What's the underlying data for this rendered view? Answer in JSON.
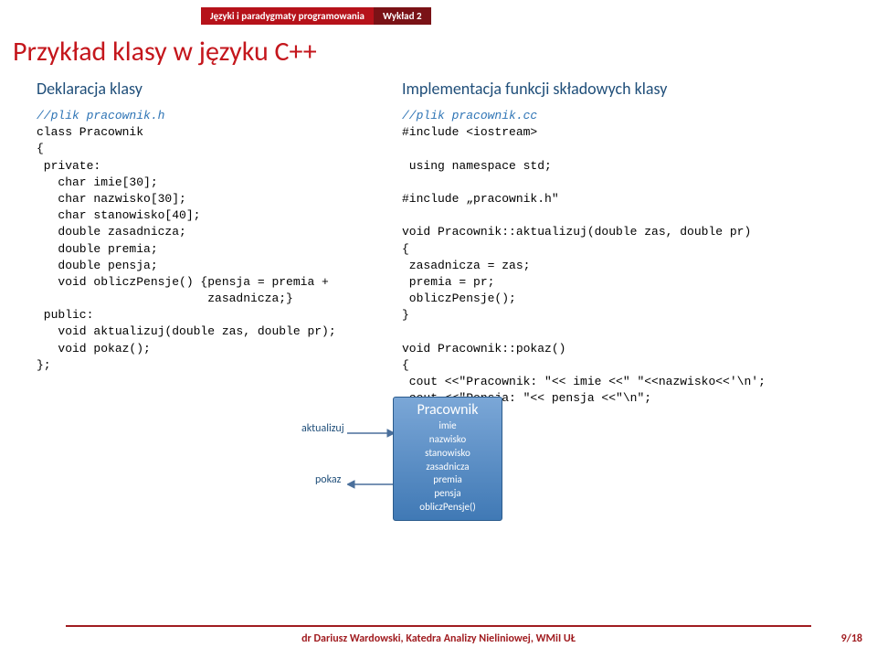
{
  "header": {
    "band_red": "Języki i paradygmaty programowania",
    "band_darkred": "Wykład 2"
  },
  "title": "Przykład klasy w języku C++",
  "subtitle_left": "Deklaracja klasy",
  "subtitle_right": "Implementacja funkcji składowych klasy",
  "code_left_comment": "//plik pracownik.h",
  "code_left_body": "class Pracownik\n{\n private:\n   char imie[30];\n   char nazwisko[30];\n   char stanowisko[40];\n   double zasadnicza;\n   double premia;\n   double pensja;\n   void obliczPensje() {pensja = premia +\n                        zasadnicza;}\n public:\n   void aktualizuj(double zas, double pr);\n   void pokaz();\n};",
  "code_right_comment": "//plik pracownik.cc",
  "code_right_body": "#include <iostream>\n\n using namespace std;\n\n#include „pracownik.h\"\n\nvoid Pracownik::aktualizuj(double zas, double pr)\n{\n zasadnicza = zas;\n premia = pr;\n obliczPensje();\n}\n\nvoid Pracownik::pokaz()\n{\n cout <<\"Pracownik: \"<< imie <<\" \"<<nazwisko<<'\\n';\n cout <<\"Pensja: \"<< pensja <<\"\\n\";\n}",
  "uml": {
    "title": "Pracownik",
    "attrs": [
      "imie",
      "nazwisko",
      "stanowisko",
      "zasadnicza",
      "premia",
      "pensja",
      "obliczPensje()"
    ],
    "label_top": "aktualizuj",
    "label_bot": "pokaz"
  },
  "footer": {
    "text": "dr Dariusz Wardowski, Katedra Analizy Nieliniowej, WMiI UŁ",
    "page": "9/18"
  }
}
